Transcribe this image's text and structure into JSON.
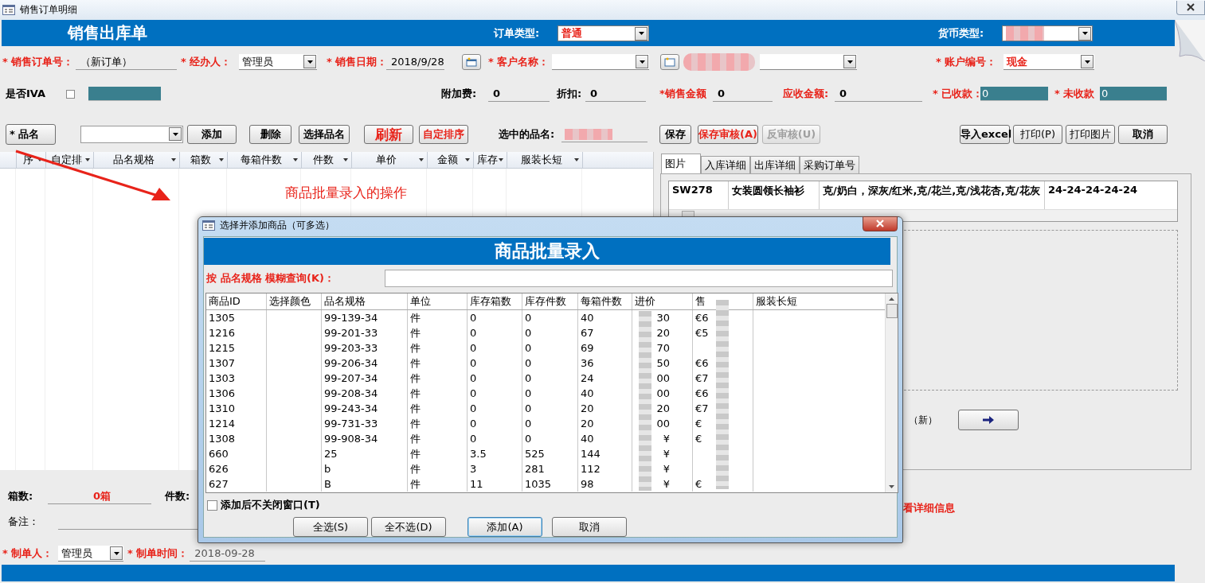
{
  "window": {
    "title": "销售订单明细"
  },
  "header": {
    "title": "销售出库单",
    "order_type": {
      "label": "订单类型:",
      "value": "普通"
    },
    "currency": {
      "label": "货币类型:"
    }
  },
  "order": {
    "order_no": {
      "label": "* 销售订单号：",
      "value": "（新订单）"
    },
    "handler": {
      "label": "* 经办人：",
      "value": "管理员"
    },
    "date": {
      "label": "* 销售日期：",
      "value": "2018/9/28"
    },
    "customer": {
      "label": "* 客户名称："
    },
    "account": {
      "label": "* 账户编号：",
      "value": "现金"
    }
  },
  "amounts": {
    "iva": {
      "label": "是否IVA",
      "checked": false
    },
    "surcharge": {
      "label": "附加费:",
      "value": "0"
    },
    "discount": {
      "label": "折扣:",
      "value": "0"
    },
    "sales": {
      "label": "*销售金额",
      "value": "0"
    },
    "receivable": {
      "label": "应收金额:",
      "value": "0"
    },
    "received": {
      "label": "* 已收款：",
      "value": "0"
    },
    "unpaid": {
      "label": "* 未收款",
      "value": "0"
    }
  },
  "item_bar": {
    "label": "* 品名",
    "buttons": [
      {
        "label": "添加",
        "kind": "plain"
      },
      {
        "label": "删除",
        "kind": "plain"
      },
      {
        "label": "选择品名",
        "kind": "plain"
      },
      {
        "label": "刷新",
        "kind": "large"
      },
      {
        "label": "自定排序",
        "kind": "red"
      }
    ],
    "selected_label": "选中的品名:"
  },
  "save_buttons": [
    {
      "label": "保存",
      "kind": "plain",
      "disabled": false
    },
    {
      "label": "保存审核(A)",
      "kind": "red",
      "disabled": false
    },
    {
      "label": "反审核(U)",
      "kind": "plain",
      "disabled": true
    }
  ],
  "output_buttons": [
    {
      "label": "导入excel",
      "kind": "bold"
    },
    {
      "label": "打印(P)",
      "kind": "plain"
    },
    {
      "label": "打印图片",
      "kind": "plain"
    },
    {
      "label": "取消",
      "kind": "bold"
    }
  ],
  "grid": {
    "columns": [
      "序",
      "自定排",
      "品名规格",
      "箱数",
      "每箱件数",
      "件数",
      "单价",
      "金额",
      "库存",
      "服装长短"
    ]
  },
  "annotation": "商品批量录入的操作",
  "tabs": [
    {
      "label": "图片",
      "selected": true
    },
    {
      "label": "入库详细",
      "selected": false
    },
    {
      "label": "出库详细",
      "selected": false
    },
    {
      "label": "采购订单号",
      "selected": false
    }
  ],
  "detail_row": [
    "SW278",
    "女装圆领长袖衫",
    "克/奶白，深灰/红米,克/花兰,克/浅花杏,克/花灰",
    "24-24-24-24-24"
  ],
  "new_label": "（新）",
  "hint": "看详细信息",
  "footer": {
    "boxes": {
      "label": "箱数:",
      "value": "0箱"
    },
    "pieces": {
      "label": "件数:"
    },
    "note": {
      "label": "备注："
    },
    "maker": {
      "label": "* 制单人：",
      "value": "管理员"
    },
    "made_time": {
      "label": "* 制单时间：",
      "value": "2018-09-28"
    }
  },
  "dialog": {
    "title": "选择并添加商品（可多选）",
    "heading": "商品批量录入",
    "search_label": "按 品名规格 模糊查询(K)：",
    "columns": [
      "商品ID",
      "选择颜色",
      "品名规格",
      "单位",
      "库存箱数",
      "库存件数",
      "每箱件数",
      "进价",
      "售",
      "服装长短"
    ],
    "rows": [
      [
        "1305",
        null,
        "99-139-34",
        "件",
        "0",
        "0",
        "40",
        "30",
        "€6"
      ],
      [
        "1216",
        null,
        "99-201-33",
        "件",
        "0",
        "0",
        "67",
        "20",
        "€5"
      ],
      [
        "1215",
        null,
        "99-203-33",
        "件",
        "0",
        "0",
        "69",
        "70",
        null
      ],
      [
        "1307",
        null,
        "99-206-34",
        "件",
        "0",
        "0",
        "36",
        "50",
        "€6"
      ],
      [
        "1303",
        null,
        "99-207-34",
        "件",
        "0",
        "0",
        "24",
        "00",
        "€7"
      ],
      [
        "1306",
        null,
        "99-208-34",
        "件",
        "0",
        "0",
        "40",
        "00",
        "€6"
      ],
      [
        "1310",
        null,
        "99-243-34",
        "件",
        "0",
        "0",
        "20",
        "20",
        "€7"
      ],
      [
        "1214",
        null,
        "99-731-33",
        "件",
        "0",
        "0",
        "20",
        "00",
        "€"
      ],
      [
        "1308",
        null,
        "99-908-34",
        "件",
        "0",
        "0",
        "40",
        "¥",
        "€"
      ],
      [
        "660",
        null,
        "25",
        "件",
        "3.5",
        "525",
        "144",
        "¥",
        null
      ],
      [
        "626",
        null,
        "b",
        "件",
        "3",
        "281",
        "112",
        "¥",
        null
      ],
      [
        "627",
        null,
        "B",
        "件",
        "11",
        "1035",
        "98",
        "¥",
        "€"
      ]
    ],
    "keep_open": {
      "label": "添加后不关闭窗口(T)",
      "checked": false
    },
    "buttons": [
      {
        "label": "全选(S)",
        "focused": false
      },
      {
        "label": "全不选(D)",
        "focused": false
      },
      {
        "label": "添加(A)",
        "focused": true
      },
      {
        "label": "取消",
        "focused": false
      }
    ]
  }
}
